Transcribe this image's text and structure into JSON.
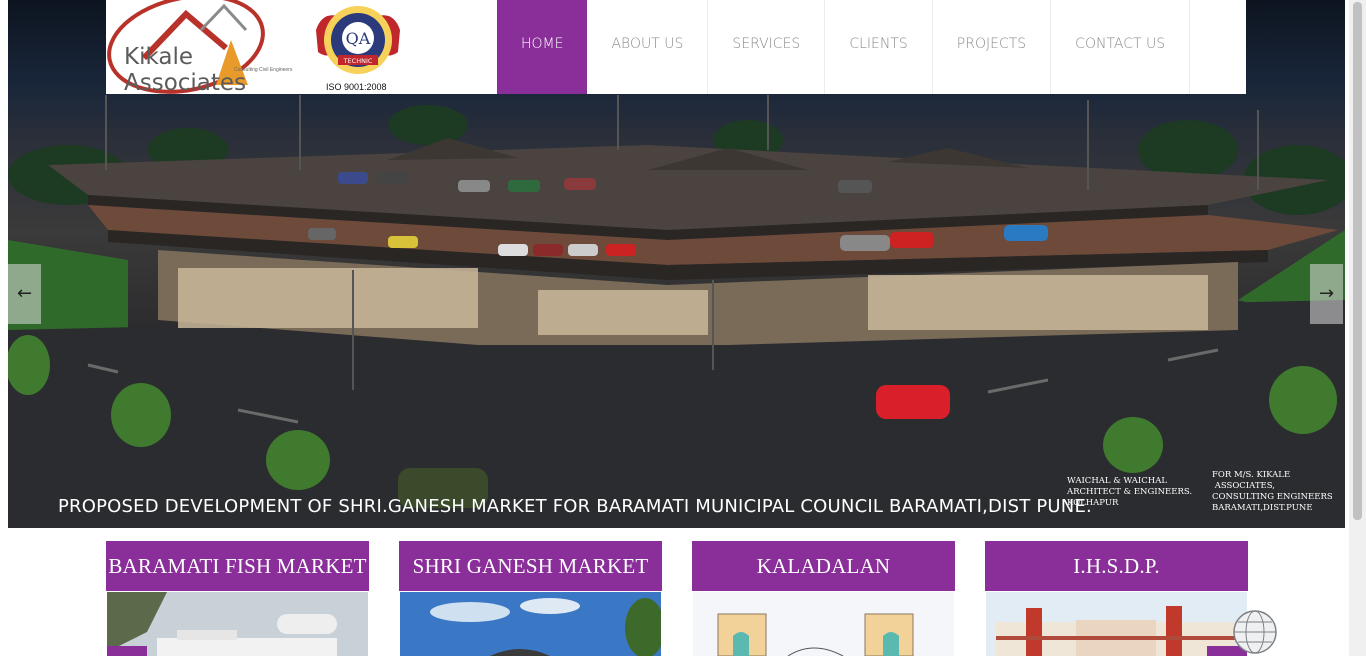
{
  "brand": {
    "logo_text": "Kikale Associates",
    "logo_tagline": "Consulting Civil Engineers",
    "cert_text": "ISO 9001:2008",
    "qa_seal_text": "QA TECHNIC",
    "accent": "#8a2f99"
  },
  "nav": {
    "items": [
      {
        "label": "HOME",
        "active": true
      },
      {
        "label": "ABOUT US",
        "active": false
      },
      {
        "label": "SERVICES",
        "active": false
      },
      {
        "label": "CLIENTS",
        "active": false
      },
      {
        "label": "PROJECTS",
        "active": false
      },
      {
        "label": "CONTACT US",
        "active": false
      }
    ]
  },
  "slider": {
    "prev_icon": "arrow-left-icon",
    "prev_glyph": "←",
    "next_icon": "arrow-right-icon",
    "next_glyph": "→",
    "caption": "PROPOSED DEVELOPMENT OF SHRI.GANESH MARKET FOR BARAMATI MUNICIPAL COUNCIL BARAMATI,DIST PUNE.",
    "credit_architect": "WAICHAL & WAICHAL\nARCHITECT & ENGINEERS.\nKOLHAPUR",
    "credit_consultant": "FOR M/S. KIKALE\n ASSOCIATES,\nCONSULTING ENGINEERS\nBARAMATI,DIST.PUNE"
  },
  "projects": [
    {
      "title": "BARAMATI FISH MARKET"
    },
    {
      "title": "SHRI GANESH MARKET"
    },
    {
      "title": "KALADALAN"
    },
    {
      "title": "I.H.S.D.P."
    }
  ]
}
